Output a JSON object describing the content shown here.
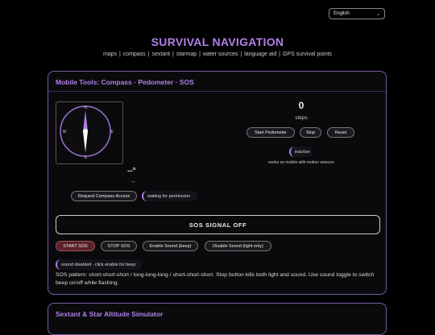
{
  "language": {
    "selected": "English"
  },
  "site": {
    "title": "SURVIVAL NAVIGATION",
    "nav": [
      "maps",
      "compass",
      "sextant",
      "starmap",
      "water sources",
      "language aid",
      "GPS survival points"
    ]
  },
  "mobile_tools": {
    "title": "Mobile Tools: Compass · Pedometer · SOS",
    "compass": {
      "north": "N",
      "south": "S",
      "east": "E",
      "west": "W",
      "heading": "--°",
      "direction": "--",
      "request_label": "Request Compass Access",
      "status": "waiting for permission"
    },
    "pedometer": {
      "steps": "0",
      "steps_label": "steps",
      "start_label": "Start Pedometer",
      "stop_label": "Stop",
      "reset_label": "Reset",
      "status": "inactive",
      "note": "works on mobile with motion sensors"
    },
    "sos": {
      "display": "SOS SIGNAL OFF",
      "start_label": "START SOS",
      "stop_label": "STOP SOS",
      "enable_sound_label": "Enable Sound (beep)",
      "disable_sound_label": "Disable Sound (light only)",
      "sound_status": "sound disabled - click enable for beep",
      "description": "SOS pattern: short-short-short / long-long-long / short-short-short. Stop button kills both light and sound. Use sound toggle to switch beep on/off while flashing."
    }
  },
  "sextant": {
    "title": "Sextant & Star Altitude Simulator"
  },
  "colors": {
    "accent": "#b080e8",
    "card_border": "#7a5aa8",
    "needle_north": "#b080e8",
    "needle_south": "#ffffff",
    "sos_start_bg": "#5a2228"
  }
}
